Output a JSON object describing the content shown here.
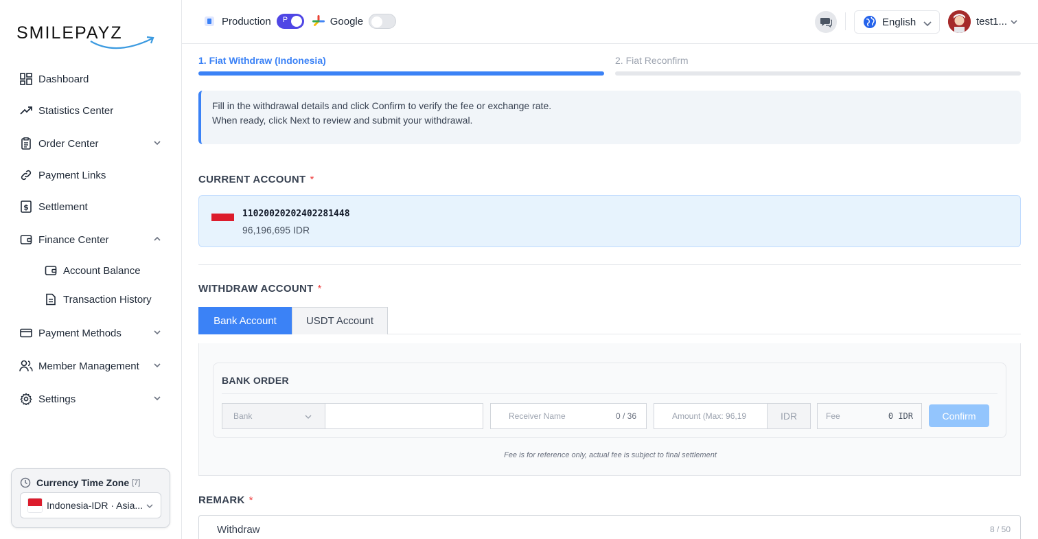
{
  "brand": {
    "logo_text": "SMILEPAYZ"
  },
  "sidebar": {
    "items": [
      {
        "label": "Dashboard"
      },
      {
        "label": "Statistics Center"
      },
      {
        "label": "Order Center"
      },
      {
        "label": "Payment Links"
      },
      {
        "label": "Settlement"
      },
      {
        "label": "Finance Center"
      },
      {
        "label": "Account Balance"
      },
      {
        "label": "Transaction History"
      },
      {
        "label": "Payment Methods"
      },
      {
        "label": "Member Management"
      },
      {
        "label": "Settings"
      }
    ],
    "timezone": {
      "title": "Currency Time Zone",
      "count": "[7]",
      "selected": "Indonesia-IDR · Asia..."
    }
  },
  "header": {
    "env_label": "Production",
    "env_toggle_letter": "P",
    "google_label": "Google",
    "language": "English",
    "user_name": "test1..."
  },
  "steps": [
    {
      "label": "1. Fiat Withdraw (Indonesia)",
      "active": true
    },
    {
      "label": "2. Fiat Reconfirm",
      "active": false
    }
  ],
  "info": {
    "line1": "Fill in the withdrawal details and click Confirm to verify the fee or exchange rate.",
    "line2": "When ready, click Next to review and submit your withdrawal."
  },
  "current_account": {
    "label": "CURRENT ACCOUNT",
    "required": "*",
    "account_no": "11020020202402281448",
    "balance": "96,196,695 IDR"
  },
  "withdraw_account": {
    "label": "WITHDRAW ACCOUNT",
    "required": "*",
    "tabs": [
      "Bank Account",
      "USDT Account"
    ]
  },
  "bank_order": {
    "title": "BANK ORDER",
    "bank_placeholder": "Bank",
    "receiver_placeholder": "Receiver Name",
    "receiver_count": "0 / 36",
    "amount_placeholder": "Amount (Max: 96,19",
    "currency": "IDR",
    "fee_label": "Fee",
    "fee_value": "0 IDR",
    "confirm_label": "Confirm",
    "fee_note": "Fee is for reference only, actual fee is subject to final settlement"
  },
  "remark": {
    "label": "REMARK",
    "required": "*",
    "value": "Withdraw",
    "count": "8 / 50"
  },
  "colors": {
    "primary": "#3b82f6",
    "toggle_on": "#4f46e5",
    "required": "#ef4444",
    "flag_red": "#dc1c2c"
  }
}
